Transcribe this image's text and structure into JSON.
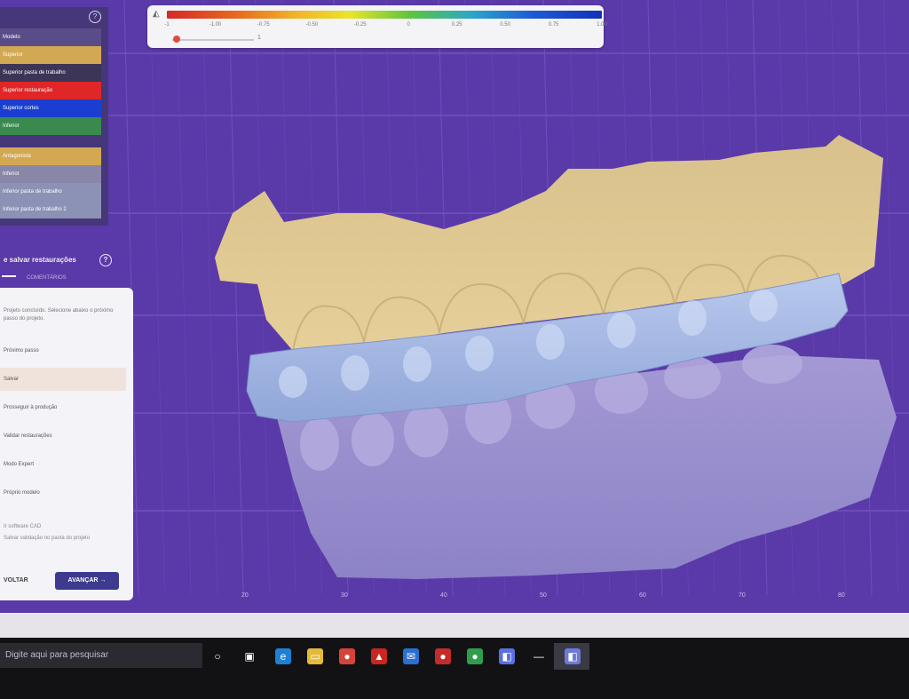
{
  "color_scale": {
    "icon": "scale-settings-icon",
    "ticks": [
      "-1",
      "-1.00",
      "-0.75",
      "-0.50",
      "-0.25",
      "0",
      "0.25",
      "0.50",
      "0.75",
      "1.00"
    ],
    "slider_value": "1",
    "slider_fraction": 0.05,
    "colors": [
      "#d62828",
      "#e66a1f",
      "#f1b52a",
      "#e7e52e",
      "#5dc43e",
      "#2aa8c8",
      "#1e5bd6",
      "#1231b8"
    ]
  },
  "layers_panel": {
    "help_icon": "help-icon",
    "items": [
      {
        "label": "Modelo",
        "color": "#5a4c88"
      },
      {
        "label": "Superior",
        "color": "#d3a853"
      },
      {
        "label": "Superior pasta de trabalho",
        "color": "#3c3556"
      },
      {
        "label": "Superior restauração",
        "color": "#e02626"
      },
      {
        "label": "Superior cortes",
        "color": "#1a3fd0"
      },
      {
        "label": "Inferior",
        "color": "#3a8a4e"
      },
      {
        "label": "Antagonista",
        "color": "#d3a853"
      },
      {
        "label": "Inferior",
        "color": "#8a86a8"
      },
      {
        "label": "Inferior pasta de trabalho",
        "color": "#8b92b5"
      },
      {
        "label": "Inferior pasta de trabalho 2",
        "color": "#8b92b5"
      }
    ]
  },
  "workflow_panel": {
    "title": "e salvar restaurações",
    "help_icon": "help-icon",
    "tabs": [
      "",
      "COMENTÁRIOS"
    ],
    "description": "Projeto concluído. Selecione abaixo o próximo passo do projeto.",
    "options": [
      "Próximo passo",
      "Salvar",
      "Prosseguir à produção",
      "Validar restaurações",
      "Modo Expert",
      "Próprio modelo"
    ],
    "footer_line1": "Ir software CAD",
    "footer_line2": "Salvar validação no pasta do projeto",
    "back_label": "VOLTAR",
    "next_label": "AVANÇAR"
  },
  "viewport": {
    "x_axis_ticks": [
      "20",
      "30",
      "40",
      "50",
      "60",
      "70",
      "80"
    ],
    "background": "#5a3aa8"
  },
  "taskbar": {
    "search_placeholder": "Digite aqui para pesquisar",
    "icons": [
      "cortana-icon",
      "task-view-icon",
      "edge-icon",
      "file-explorer-icon",
      "chrome-icon",
      "acrobat-icon",
      "mail-icon",
      "media-player-icon",
      "chrome-alt-icon",
      "cad-app-icon",
      "minimize-icon",
      "cad-app-active-icon"
    ]
  }
}
